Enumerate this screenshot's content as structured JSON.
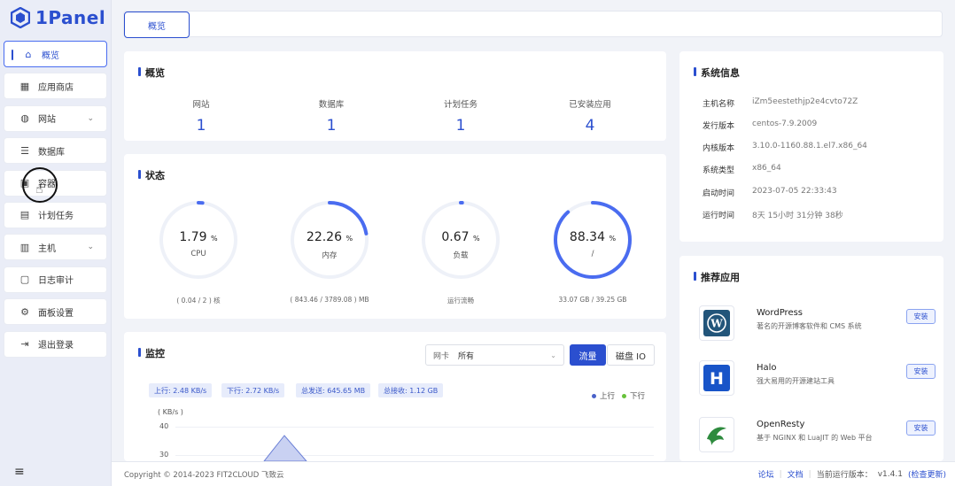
{
  "app": {
    "name": "1Panel"
  },
  "sidebar": {
    "items": [
      {
        "label": "概览",
        "icon": "home-icon",
        "glyph": "⌂",
        "active": true
      },
      {
        "label": "应用商店",
        "icon": "grid-icon",
        "glyph": "▦"
      },
      {
        "label": "网站",
        "icon": "globe-icon",
        "glyph": "◍",
        "chevron": true
      },
      {
        "label": "数据库",
        "icon": "database-icon",
        "glyph": "☰"
      },
      {
        "label": "容器",
        "icon": "container-icon",
        "glyph": "▣"
      },
      {
        "label": "计划任务",
        "icon": "calendar-icon",
        "glyph": "▤"
      },
      {
        "label": "主机",
        "icon": "host-icon",
        "glyph": "▥",
        "chevron": true
      },
      {
        "label": "日志审计",
        "icon": "log-icon",
        "glyph": "▢"
      },
      {
        "label": "面板设置",
        "icon": "gear-icon",
        "glyph": "⚙"
      },
      {
        "label": "退出登录",
        "icon": "logout-icon",
        "glyph": "⇥"
      }
    ],
    "collapse_glyph": "≡"
  },
  "topbar": {
    "tab": "概览"
  },
  "overview": {
    "title": "概览",
    "items": [
      {
        "label": "网站",
        "value": "1"
      },
      {
        "label": "数据库",
        "value": "1"
      },
      {
        "label": "计划任务",
        "value": "1"
      },
      {
        "label": "已安装应用",
        "value": "4"
      }
    ]
  },
  "status": {
    "title": "状态",
    "gauges": [
      {
        "value": "1.79",
        "unit": "%",
        "name": "CPU",
        "footer": "( 0.04 / 2 ) 核",
        "percent": 1.79
      },
      {
        "value": "22.26",
        "unit": "%",
        "name": "内存",
        "footer": "( 843.46 / 3789.08 ) MB",
        "percent": 22.26
      },
      {
        "value": "0.67",
        "unit": "%",
        "name": "负载",
        "footer": "运行流畅",
        "percent": 0.67
      },
      {
        "value": "88.34",
        "unit": "%",
        "name": "/",
        "footer": "33.07 GB / 39.25 GB",
        "percent": 88.34
      }
    ]
  },
  "monitor": {
    "title": "监控",
    "select_label": "网卡",
    "select_value": "所有",
    "btn_traffic": "流量",
    "btn_disk": "磁盘 IO",
    "stats": [
      "上行: 2.48 KB/s",
      "下行: 2.72 KB/s",
      "总发送: 645.65 MB",
      "总接收: 1.12 GB"
    ],
    "legend_up": "上行",
    "legend_down": "下行",
    "unit_label": "( KB/s )",
    "y_ticks": [
      "40",
      "30"
    ],
    "colors": {
      "up": "#4a62c9",
      "down": "#67c23a"
    }
  },
  "sysinfo": {
    "title": "系统信息",
    "rows": [
      {
        "key": "主机名称",
        "value": "iZm5eestethjp2e4cvto72Z"
      },
      {
        "key": "发行版本",
        "value": "centos-7.9.2009"
      },
      {
        "key": "内核版本",
        "value": "3.10.0-1160.88.1.el7.x86_64"
      },
      {
        "key": "系统类型",
        "value": "x86_64"
      },
      {
        "key": "启动时间",
        "value": "2023-07-05 22:33:43"
      },
      {
        "key": "运行时间",
        "value": "8天 15小时 31分钟 38秒"
      }
    ]
  },
  "recommend": {
    "title": "推荐应用",
    "install_label": "安装",
    "apps": [
      {
        "name": "WordPress",
        "desc": "著名的开源博客软件和 CMS 系统",
        "icon": "wordpress-icon"
      },
      {
        "name": "Halo",
        "desc": "强大易用的开源建站工具",
        "icon": "halo-icon"
      },
      {
        "name": "OpenResty",
        "desc": "基于 NGINX 和 LuaJIT 的 Web 平台",
        "icon": "openresty-icon"
      }
    ]
  },
  "footer": {
    "copyright": "Copyright © 2014-2023 FIT2CLOUD 飞致云",
    "forum": "论坛",
    "docs": "文档",
    "version_label": "当前运行版本：",
    "version": "v1.4.1",
    "check_update": "(检查更新)"
  }
}
